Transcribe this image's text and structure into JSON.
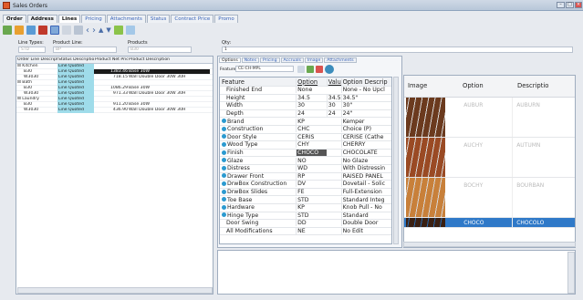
{
  "window": {
    "title": "Sales Orders"
  },
  "main_tabs": [
    "Order",
    "Address",
    "Lines",
    "Pricing",
    "Attachments",
    "Status",
    "Contract Price",
    "Promo"
  ],
  "fields": {
    "line_types_label": "Line Types:",
    "line_types_value": "STD",
    "product_line_label": "Product Line:",
    "product_line_value": "BP",
    "products_label": "Products",
    "products_value": "B30",
    "qty_label": "Qty:",
    "qty_value": "1"
  },
  "lines_grid": {
    "headers": [
      "Order Line Description",
      "Status Description",
      "Product Net Price",
      "Product Description"
    ],
    "rows": [
      {
        "c1": "⊟ Kitchen",
        "c2": "Line Quoted",
        "c3": "",
        "c4": ""
      },
      {
        "c1": "B30",
        "c2": "Line Quoted",
        "c3": "1383.46",
        "c4": "Base 30W",
        "hl": true
      },
      {
        "c1": "W3030",
        "c2": "Line Quoted",
        "c3": "718.15",
        "c4": "Wall Double Door 30W 30H"
      },
      {
        "c1": "⊟ Bath",
        "c2": "Line Quoted",
        "c3": "",
        "c4": ""
      },
      {
        "c1": "B30",
        "c2": "Line Quoted",
        "c3": "1086.29",
        "c4": "Base 30W"
      },
      {
        "c1": "W3030",
        "c2": "Line Quoted",
        "c3": "971.33",
        "c4": "Wall Double Door 30W 30H"
      },
      {
        "c1": "⊟ Laundry",
        "c2": "Line Quoted",
        "c3": "",
        "c4": ""
      },
      {
        "c1": "B30",
        "c2": "Line Quoted",
        "c3": "911.20",
        "c4": "Base 30W"
      },
      {
        "c1": "W3030",
        "c2": "Line Quoted",
        "c3": "436.90",
        "c4": "Wall Double Door 30W 30H"
      }
    ]
  },
  "option_tabs": [
    "Options",
    "Notes",
    "Pricing",
    "Accruals",
    "Image",
    "Attachments"
  ],
  "feature_set": {
    "label": "Feature Set:",
    "value": "CE-CH-MPL"
  },
  "feature_grid": {
    "headers": [
      "Feature",
      "Option",
      "Value",
      "Option Descrip"
    ],
    "rows": [
      {
        "f": "Finished End",
        "o": "None",
        "v": "",
        "d": "None - No Upcl",
        "dot": false
      },
      {
        "f": "Height",
        "o": "34.5",
        "v": "34.5",
        "d": "34.5\"",
        "dot": false
      },
      {
        "f": "Width",
        "o": "30",
        "v": "30",
        "d": "30\"",
        "dot": false
      },
      {
        "f": "Depth",
        "o": "24",
        "v": "24",
        "d": "24\"",
        "dot": false
      },
      {
        "f": "Brand",
        "o": "KP",
        "v": "",
        "d": "Kemper",
        "dot": true
      },
      {
        "f": "Construction",
        "o": "CHC",
        "v": "",
        "d": "Choice (P)",
        "dot": true
      },
      {
        "f": "Door Style",
        "o": "CERIS",
        "v": "",
        "d": "CERISE (Cathe",
        "dot": true
      },
      {
        "f": "Wood Type",
        "o": "CHY",
        "v": "",
        "d": "CHERRY",
        "dot": true
      },
      {
        "f": "Finish",
        "o": "CHOCO",
        "v": "",
        "d": "CHOCOLATE",
        "dot": true,
        "sel": true
      },
      {
        "f": "Glaze",
        "o": "NO",
        "v": "",
        "d": "No Glaze",
        "dot": true
      },
      {
        "f": "Distress",
        "o": "WD",
        "v": "",
        "d": "With Distressin",
        "dot": true
      },
      {
        "f": "Drawer Front",
        "o": "RP",
        "v": "",
        "d": "RAISED PANEL",
        "dot": true
      },
      {
        "f": "DrwBox Construction",
        "o": "DV",
        "v": "",
        "d": "Dovetail - Solic",
        "dot": true
      },
      {
        "f": "DrwBox Slides",
        "o": "FE",
        "v": "",
        "d": "Full-Extension",
        "dot": true
      },
      {
        "f": "Toe Base",
        "o": "STD",
        "v": "",
        "d": "Standard Integ",
        "dot": true
      },
      {
        "f": "Hardware",
        "o": "KP",
        "v": "",
        "d": "Knob Pull - No",
        "dot": true
      },
      {
        "f": "Hinge Type",
        "o": "STD",
        "v": "",
        "d": "Standard",
        "dot": true
      },
      {
        "f": "Door Swing",
        "o": "DD",
        "v": "",
        "d": "Double Door",
        "dot": false
      },
      {
        "f": "All Modifications",
        "o": "NE",
        "v": "",
        "d": "No Edit",
        "dot": false
      }
    ]
  },
  "image_grid": {
    "headers": [
      "Image",
      "Option",
      "Descriptio"
    ],
    "rows": [
      {
        "o": "AUBUR",
        "d": "AUBURN",
        "color": "#6b3a1e"
      },
      {
        "o": "AUCHY",
        "d": "AUTUMN",
        "color": "#9a4a24"
      },
      {
        "o": "BOCHY",
        "d": "BOURBAN",
        "color": "#c8803a"
      },
      {
        "o": "CHOCO",
        "d": "CHOCOLO",
        "color": "#3a2012",
        "sel": true
      }
    ]
  }
}
